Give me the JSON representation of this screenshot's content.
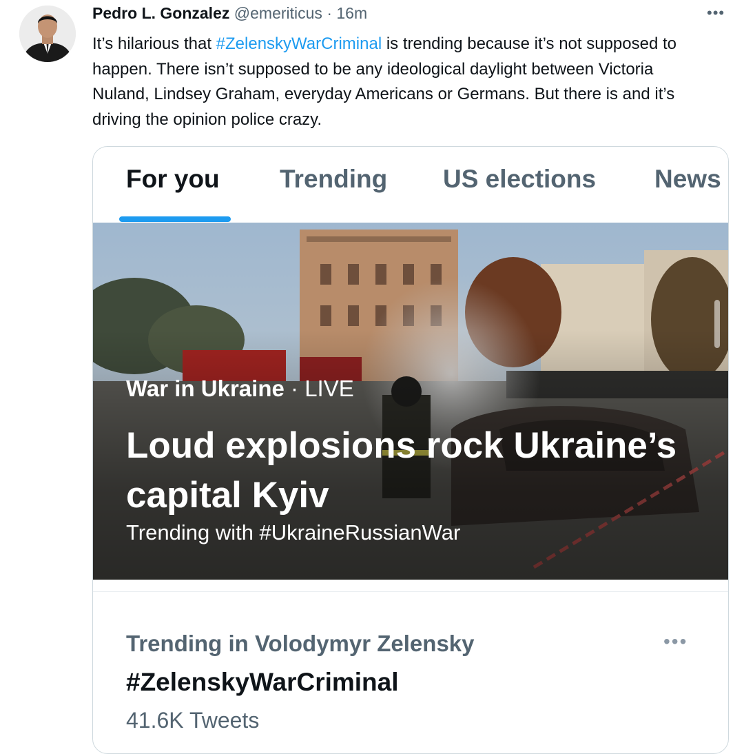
{
  "tweet": {
    "author_name": "Pedro L. Gonzalez",
    "handle": "@emeriticus",
    "separator": "·",
    "time": "16m",
    "more_icon": "more-horizontal-icon",
    "more_glyph": "•••",
    "text_before": "It’s hilarious that ",
    "hashtag": "#ZelenskyWarCriminal",
    "text_after": " is trending because it’s not supposed to happen. There isn’t supposed to be any ideological daylight between Victoria Nuland, Lindsey Graham, everyday Americans or Germans. But there is and it’s driving the opinion police crazy."
  },
  "card": {
    "tabs": [
      {
        "label": "For you",
        "active": true
      },
      {
        "label": "Trending",
        "active": false
      },
      {
        "label": "US elections",
        "active": false
      },
      {
        "label": "News",
        "active": false
      }
    ],
    "hero": {
      "topic": "War in Ukraine",
      "separator": "·",
      "live": "LIVE",
      "headline": "Loud explosions rock Ukraine’s capital Kyiv",
      "subtitle": "Trending with #UkraineRussianWar"
    },
    "trend": {
      "context": "Trending in Volodymyr Zelensky",
      "name": "#ZelenskyWarCriminal",
      "count": "41.6K Tweets",
      "more_glyph": "•••"
    }
  },
  "colors": {
    "link": "#1d9bf0",
    "text_primary": "#0f1419",
    "text_secondary": "#536471",
    "border": "#cfd9de"
  }
}
